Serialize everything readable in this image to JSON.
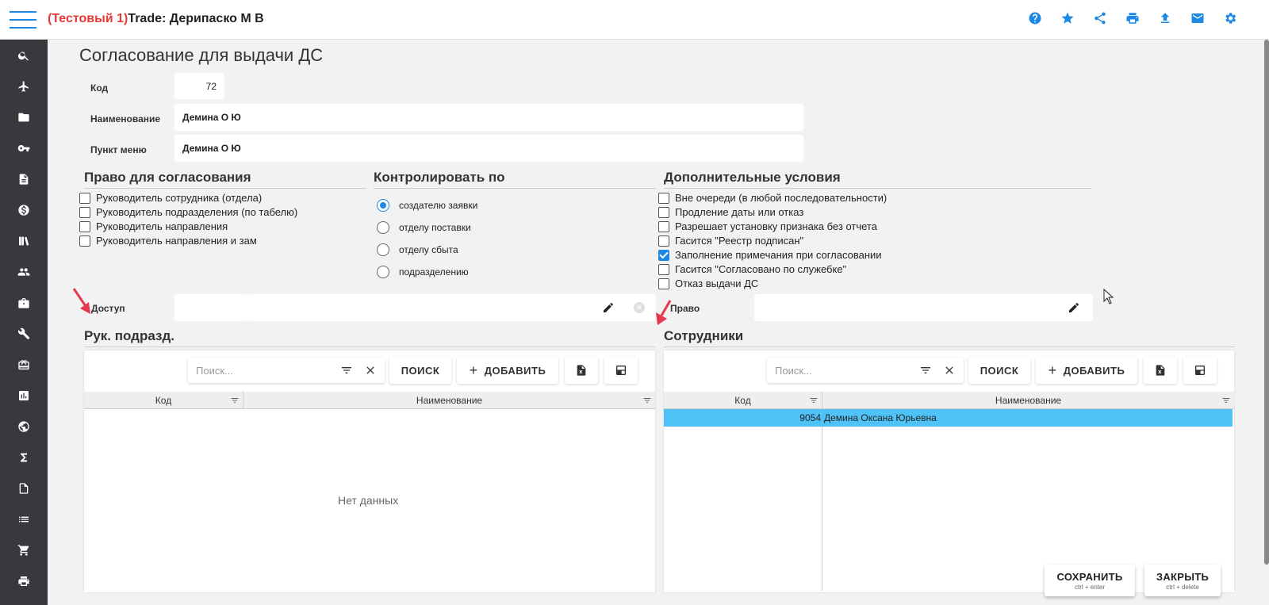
{
  "header": {
    "test_tag": "(Тестовый 1)",
    "title": "Trade: Дерипаско М В",
    "icons": [
      "help-icon",
      "star-icon",
      "share-icon",
      "print-icon",
      "upload-icon",
      "mail-icon",
      "gear-icon"
    ]
  },
  "sidebar": {
    "icons": [
      "search-icon",
      "airplane-icon",
      "folder-icon",
      "key-icon",
      "document-icon",
      "dollar-icon",
      "books-icon",
      "people-icon",
      "briefcase-icon",
      "wrench-icon",
      "box-icon",
      "chart-icon",
      "globe-icon",
      "sigma-icon",
      "file-icon",
      "list-icon",
      "cart-icon",
      "printer-icon"
    ]
  },
  "page": {
    "title": "Согласование для выдачи ДС"
  },
  "form": {
    "code_label": "Код",
    "code_value": "72",
    "name_label": "Наименование",
    "name_value": "Демина О Ю",
    "menu_label": "Пункт меню",
    "menu_value": "Демина О Ю",
    "access_label": "Доступ",
    "right_label": "Право"
  },
  "rights": {
    "title": "Право для согласования",
    "items": [
      {
        "label": "Руководитель сотрудника (отдела)",
        "checked": false
      },
      {
        "label": "Руководитель подразделения (по табелю)",
        "checked": false
      },
      {
        "label": "Руководитель направления",
        "checked": false
      },
      {
        "label": "Руководитель направления и зам",
        "checked": false
      }
    ]
  },
  "control": {
    "title": "Контролировать по",
    "items": [
      {
        "label": "создателю заявки",
        "checked": true
      },
      {
        "label": "отделу поставки",
        "checked": false
      },
      {
        "label": "отделу сбыта",
        "checked": false
      },
      {
        "label": "подразделению",
        "checked": false
      }
    ]
  },
  "extra": {
    "title": "Дополнительные условия",
    "items": [
      {
        "label": "Вне очереди (в любой последовательности)",
        "checked": false
      },
      {
        "label": "Продление даты или отказ",
        "checked": false
      },
      {
        "label": "Разрешает установку признака без отчета",
        "checked": false
      },
      {
        "label": "Гасится \"Реестр подписан\"",
        "checked": false
      },
      {
        "label": "Заполнение примечания при согласовании",
        "checked": true
      },
      {
        "label": "Гасится \"Согласовано по служебке\"",
        "checked": false
      },
      {
        "label": "Отказ выдачи ДС",
        "checked": false
      }
    ]
  },
  "left_grid": {
    "title": "Рук. подразд.",
    "search_placeholder": "Поиск...",
    "search_label": "ПОИСК",
    "add_label": "ДОБАВИТЬ",
    "col_code": "Код",
    "col_name": "Наименование",
    "empty_text": "Нет данных"
  },
  "right_grid": {
    "title": "Сотрудники",
    "search_placeholder": "Поиск...",
    "search_label": "ПОИСК",
    "add_label": "ДОБАВИТЬ",
    "col_code": "Код",
    "col_name": "Наименование",
    "rows": [
      {
        "code": "9054",
        "name": "Демина Оксана Юрьевна"
      }
    ]
  },
  "actions": {
    "save_label": "СОХРАНИТЬ",
    "save_hint": "ctrl + enter",
    "close_label": "ЗАКРЫТЬ",
    "close_hint": "ctrl + delete"
  },
  "colors": {
    "accent": "#1e88e5",
    "test_tag": "#e53935",
    "selected_row": "#4fc3f7",
    "sidebar": "#37393d",
    "arrow": "#e53950"
  }
}
